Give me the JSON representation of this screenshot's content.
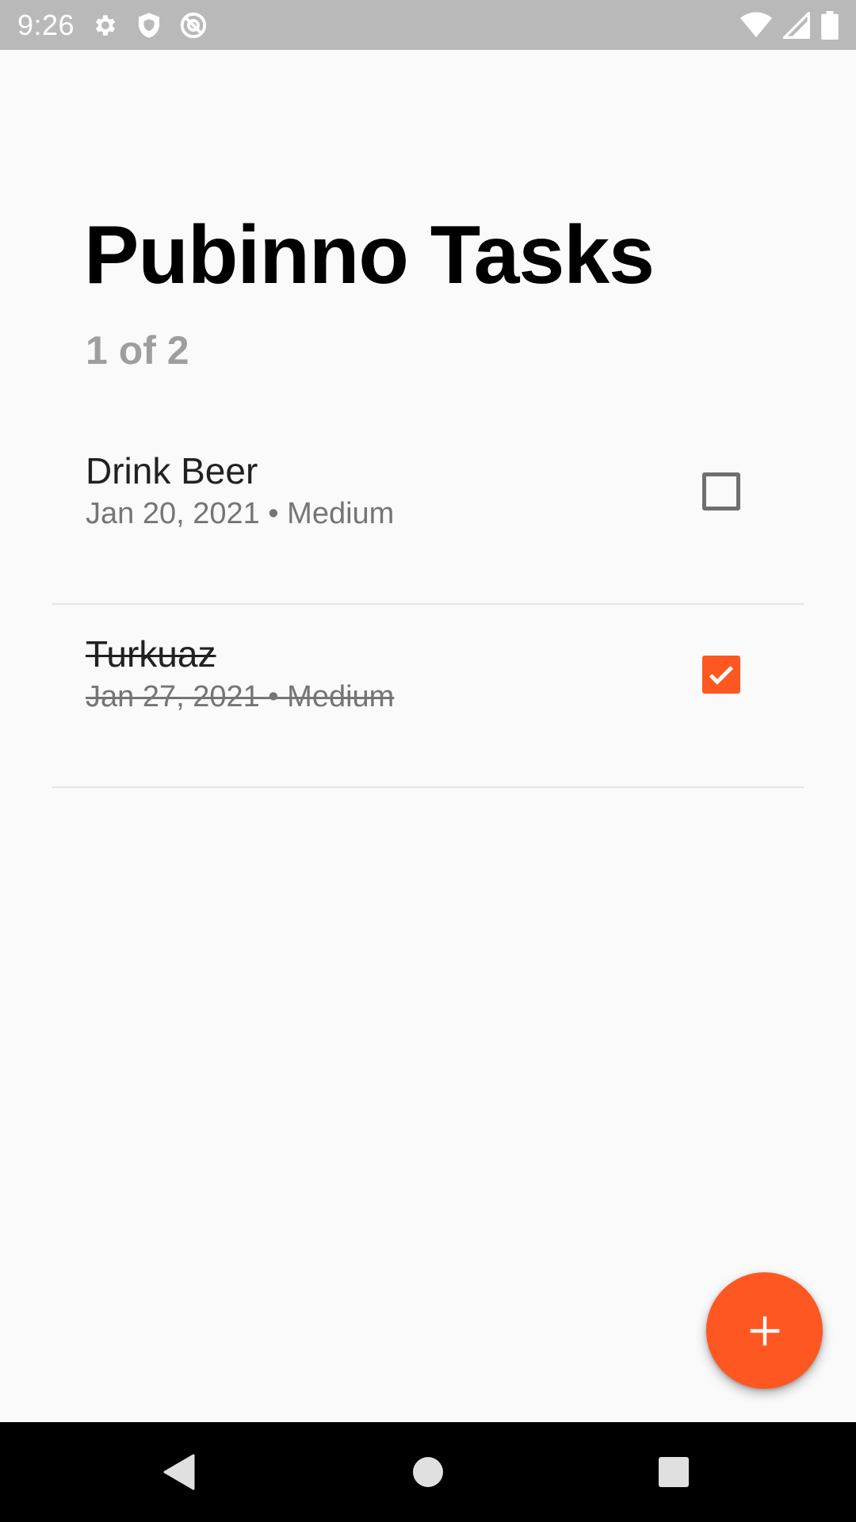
{
  "status_bar": {
    "time": "9:26",
    "left_icons": [
      "gear-icon",
      "shield-icon",
      "at-sign-icon"
    ],
    "right_icons": [
      "wifi-icon",
      "cell-signal-icon",
      "battery-icon"
    ]
  },
  "header": {
    "title": "Pubinno Tasks",
    "subtitle": "1 of 2"
  },
  "tasks": [
    {
      "title": "Drink Beer",
      "meta": "Jan 20, 2021 • Medium",
      "completed": false
    },
    {
      "title": "Turkuaz",
      "meta": "Jan 27, 2021 • Medium",
      "completed": true
    }
  ],
  "fab": {
    "icon": "plus-icon"
  },
  "nav_bar": {
    "icons": [
      "back-triangle-icon",
      "home-circle-icon",
      "recents-square-icon"
    ]
  },
  "colors": {
    "accent": "#ff5722",
    "status_bar": "#b9b9b9",
    "background": "#fafafa",
    "subtitle": "#9e9e9e",
    "meta_text": "#757575"
  }
}
